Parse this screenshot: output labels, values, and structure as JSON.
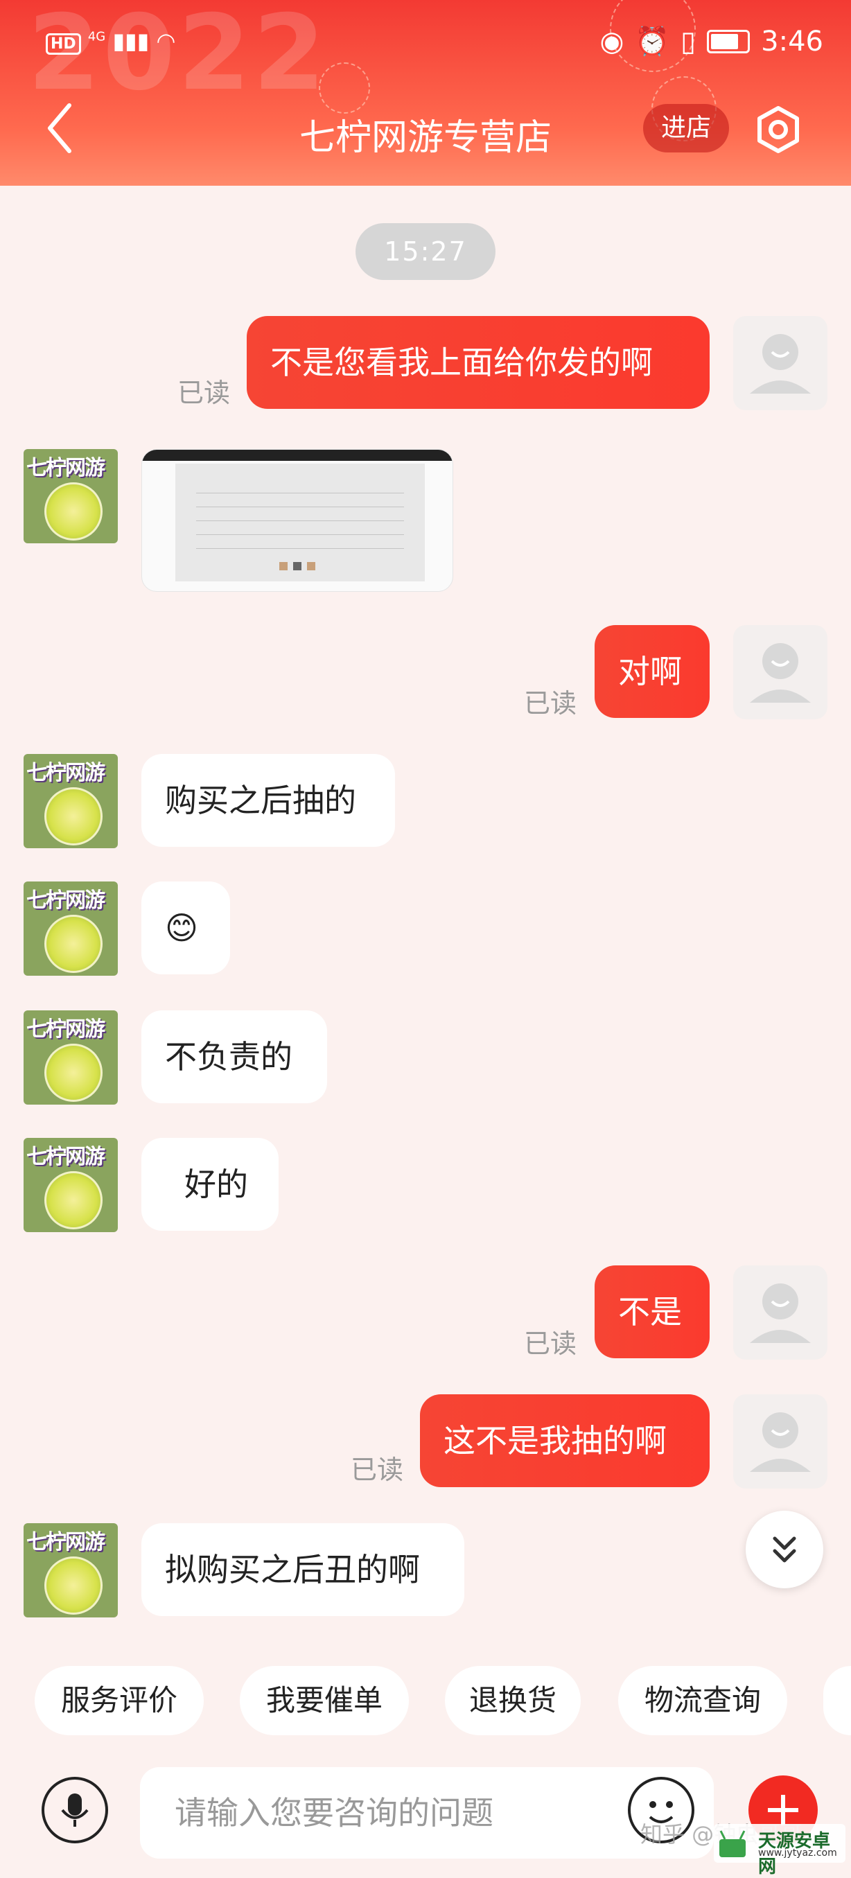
{
  "status_bar": {
    "hd": "HD",
    "signal": "4G",
    "time": "3:46"
  },
  "header": {
    "background_year": "2022",
    "title": "七柠网游专营店",
    "enter_store_label": "进店",
    "accent_color": "#f33a33"
  },
  "chat": {
    "timestamp": "15:27",
    "read_label": "已读",
    "messages": [
      {
        "from": "me",
        "text": "不是您看我上面给你发的啊",
        "read": "已读"
      },
      {
        "from": "shop",
        "type": "image",
        "avatar_text": "七柠网游"
      },
      {
        "from": "me",
        "text": "对啊",
        "read": "已读"
      },
      {
        "from": "shop",
        "text": "购买之后抽的",
        "avatar_text": "七柠网游"
      },
      {
        "from": "shop",
        "text": "😊",
        "avatar_text": "七柠网游"
      },
      {
        "from": "shop",
        "text": "不负责的",
        "avatar_text": "七柠网游"
      },
      {
        "from": "shop",
        "text": "好的",
        "avatar_text": "七柠网游"
      },
      {
        "from": "me",
        "text": "不是",
        "read": "已读"
      },
      {
        "from": "me",
        "text": "这不是我抽的啊",
        "read": "已读"
      },
      {
        "from": "shop",
        "text": "拟购买之后丑的啊",
        "avatar_text": "七柠网游"
      }
    ]
  },
  "quick_actions": [
    "服务评价",
    "我要催单",
    "退换货",
    "物流查询"
  ],
  "input_bar": {
    "placeholder": "请输入您要咨询的问题"
  },
  "watermarks": {
    "zhihu": "知乎 @钟虫哥哥",
    "site_name": "天源安卓网",
    "site_url": "www.jytyaz.com"
  }
}
